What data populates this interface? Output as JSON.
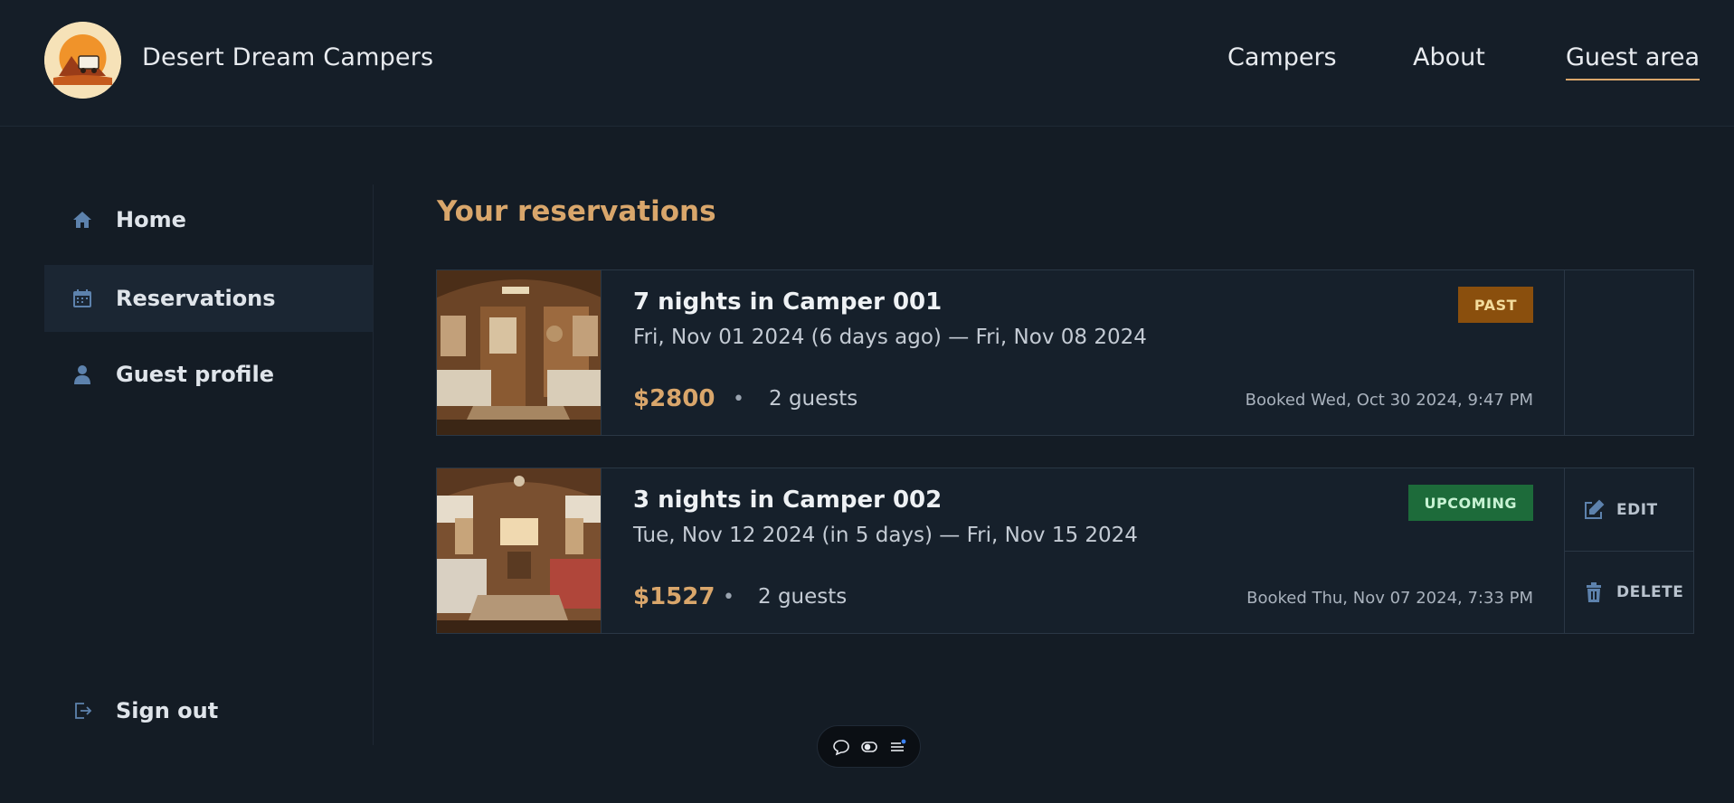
{
  "header": {
    "brand": "Desert Dream Campers",
    "nav": [
      {
        "label": "Campers"
      },
      {
        "label": "About"
      },
      {
        "label": "Guest area",
        "active": true
      }
    ]
  },
  "sidebar": {
    "items": [
      {
        "label": "Home",
        "icon": "home-icon"
      },
      {
        "label": "Reservations",
        "icon": "calendar-icon",
        "active": true
      },
      {
        "label": "Guest profile",
        "icon": "user-icon"
      }
    ],
    "sign_out": {
      "label": "Sign out",
      "icon": "sign-out-icon"
    }
  },
  "main": {
    "title": "Your reservations",
    "reservations": [
      {
        "title": "7 nights in Camper 001",
        "dates": "Fri, Nov 01 2024 (6 days ago) — Fri, Nov 08 2024",
        "price": "$2800",
        "separator": "•",
        "guests": "2 guests",
        "booked": "Booked Wed, Oct 30 2024, 9:47 PM",
        "status": "PAST"
      },
      {
        "title": "3 nights in Camper 002",
        "dates": "Tue, Nov 12 2024 (in 5 days) — Fri, Nov 15 2024",
        "price": "$1527",
        "separator": "•",
        "guests": "2 guests",
        "booked": "Booked Thu, Nov 07 2024, 7:33 PM",
        "status": "UPCOMING",
        "actions": {
          "edit": "EDIT",
          "delete": "DELETE"
        }
      }
    ]
  },
  "toolbar": {
    "icons": [
      "chat-bubble-icon",
      "eye-toggle-icon",
      "menu-icon"
    ]
  },
  "colors": {
    "accent": "#d9a66b",
    "background": "#141c25",
    "past_badge": "#8a4f0d",
    "upcoming_badge": "#1d6b3a"
  }
}
